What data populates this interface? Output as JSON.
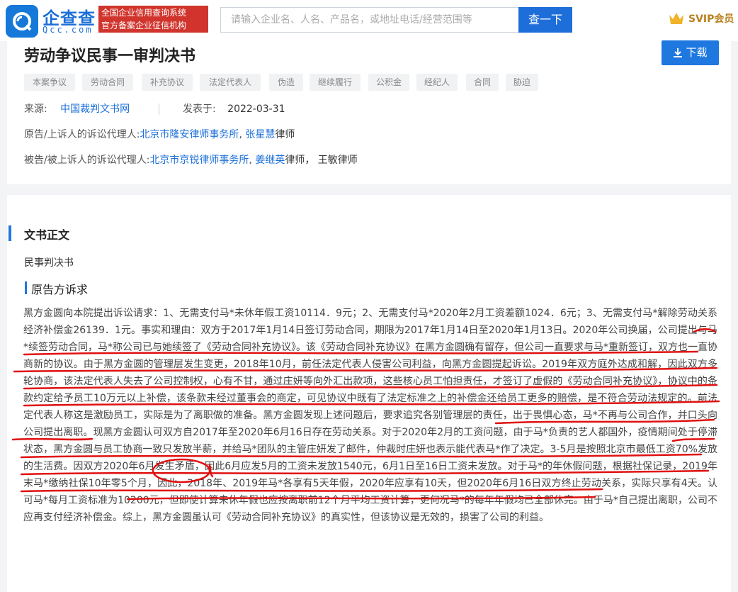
{
  "header": {
    "logo_text": "企查查",
    "logo_sub": "Qcc.com",
    "badge_line1": "全国企业信用查询系统",
    "badge_line2": "官方备案企业征信机构",
    "search_placeholder": "请输入企业名、人名、产品名，或地址电话/经营范围等",
    "search_button": "查一下",
    "svip_label": "SVIP会员"
  },
  "document": {
    "title": "劳动争议民事一审判决书",
    "download_label": "下载",
    "tags": [
      "本案争议",
      "劳动合同",
      "补充协议",
      "法定代表人",
      "伪造",
      "继续履行",
      "公积金",
      "经纪人",
      "合同",
      "胁迫"
    ],
    "source_label": "来源:",
    "source_value": "中国裁判文书网",
    "published_label": "发表于:",
    "published_value": "2022-03-31",
    "plaintiff_label": "原告/上诉人的诉讼代理人:",
    "plaintiff_firm": "北京市隆安律师事务所",
    "plaintiff_sep": ",",
    "plaintiff_lawyer": "张星慧",
    "plaintiff_suffix": "律师",
    "defendant_label": "被告/被上诉人的诉讼代理人:",
    "defendant_firm": "北京市京锐律师事务所",
    "defendant_sep": ",",
    "defendant_lawyer": "姜继英",
    "defendant_suffix": "律师，  王敏律师"
  },
  "body": {
    "section_title": "文书正文",
    "doc_type": "民事判决书",
    "sub_title": "原告方诉求",
    "paragraph": "黑方金圆向本院提出诉讼请求：1、无需支付马*未休年假工资10114．9元；2、无需支付马*2020年2月工资差额1024．6元；3、无需支付马*解除劳动关系经济补偿金26139．1元。事实和理由：双方于2017年1月14日签订劳动合同，期限为2017年1月14日至2020年1月13日。2020年公司换届，公司提出与马*续签劳动合同，马*称公司已与她续签了《劳动合同补充协议》。该《劳动合同补充协议》在黑方金圆确有留存，但公司一直要求与马*重新签订，双方也一直协商新的协议。由于黑方金圆的管理层发生变更，2018年10月，前任法定代表人侵害公司利益，向黑方金圆提起诉讼。2019年双方庭外达成和解，因此双方多轮协商，该法定代表人失去了公司控制权，心有不甘，通过庄妍等向外汇出款项，这些核心员工怕担责任，才签订了虚假的《劳动合同补充协议》，协议中的条款约定给予员工10万元以上补偿，该条款未经过董事会的商定，可见协议中既有了法定标准之上的补偿金还给员工更多的赔偿，是不符合劳动法规定的。前法定代表人称这是激励员工，实际是为了离职做的准备。黑方金圆发现上述问题后，要求追究各别管理层的责任，出于畏惧心态，马*不再与公司合作，并口头向公司提出离职。现黑方金圆认可双方自2017年至2020年6月16日存在劳动关系。对于2020年2月的工资问题，由于马*负责的艺人都国外，疫情期间处于停滞状态，黑方金圆与员工协商一致只发放半薪，并给马*团队的主管庄妍发了邮件，仲裁时庄妍也表示能代表马*作了决定。3-5月是按照北京市最低工资70%发放的生活费。因双方2020年6月发生矛盾，因此6月应发5月的工资未发放1540元，6月1日至16日工资未发放。对于马*的年休假问题，根据社保记录，2019年末马*缴纳社保10年零5个月，因此，2018年、2019年马*各享有5天年假，2020年应享有10天，但2020年6月16日双方终止劳动关系，实际只享有4天。认可马*每月工资标准为10200元，但即使计算未休年假也应按离职前12个月平均工资计算，更何况马*的每年年假均已全部休完。由于马*自己提出离职，公司不应再支付经济补偿金。综上，黑方金圆虽认可《劳动合同补充协议》的真实性，但该协议是无效的，损害了公司的利益。"
  },
  "colors": {
    "accent": "#1e78e0",
    "badge_red": "#d0342c",
    "annotation_red": "#e01010",
    "svip_gold": "#b8801c"
  }
}
